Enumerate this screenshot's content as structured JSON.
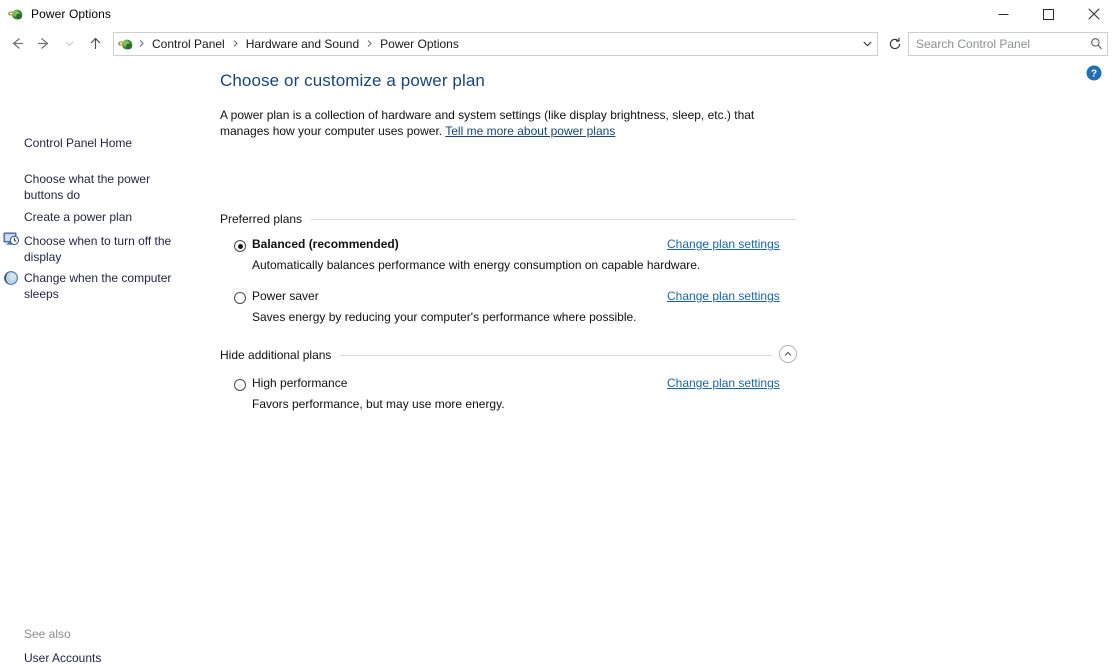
{
  "window": {
    "title": "Power Options",
    "icon": "power-plug-icon",
    "controls": {
      "minimize": "—",
      "maximize": "□",
      "close": "✕"
    }
  },
  "nav": {
    "back_icon": "arrow-left-icon",
    "forward_icon": "arrow-right-icon",
    "recent_icon": "chevron-down-icon",
    "up_icon": "arrow-up-icon",
    "address_icon": "power-plug-icon",
    "breadcrumbs": [
      "Control Panel",
      "Hardware and Sound",
      "Power Options"
    ],
    "separator": "›",
    "dropdown_icon": "chevron-down-icon",
    "refresh_icon": "refresh-icon"
  },
  "search": {
    "placeholder": "Search Control Panel",
    "icon": "search-icon"
  },
  "help": {
    "label": "?",
    "tooltip": "Help",
    "icon": "help-icon"
  },
  "sidebar": {
    "items": [
      {
        "label": "Control Panel Home",
        "icon": null
      },
      {
        "label": "Choose what the power buttons do",
        "icon": null
      },
      {
        "label": "Create a power plan",
        "icon": null
      },
      {
        "label": "Choose when to turn off the display",
        "icon": "monitor-clock-icon"
      },
      {
        "label": "Change when the computer sleeps",
        "icon": "sleep-moon-icon"
      }
    ],
    "see_also_label": "See also",
    "see_also_links": [
      "User Accounts"
    ]
  },
  "main": {
    "title": "Choose or customize a power plan",
    "intro_text": "A power plan is a collection of hardware and system settings (like display brightness, sleep, etc.) that manages how your computer uses power. ",
    "intro_link": "Tell me more about power plans",
    "sections": [
      {
        "header": "Preferred plans",
        "collapsible": false,
        "plans": [
          {
            "name": "Balanced (recommended)",
            "bold": true,
            "selected": true,
            "description": "Automatically balances performance with energy consumption on capable hardware.",
            "action": "Change plan settings"
          },
          {
            "name": "Power saver",
            "bold": false,
            "selected": false,
            "description": "Saves energy by reducing your computer's performance where possible.",
            "action": "Change plan settings"
          }
        ]
      },
      {
        "header": "Hide additional plans",
        "collapsible": true,
        "collapse_icon": "chevron-up-icon",
        "plans": [
          {
            "name": "High performance",
            "bold": false,
            "selected": false,
            "description": "Favors performance, but may use more energy.",
            "action": "Change plan settings"
          }
        ]
      }
    ]
  },
  "colors": {
    "title_blue": "#17457f",
    "link_blue": "#1667b1",
    "sidebar_text": "#1f2340",
    "rule": "#d9d9d9",
    "help_blue": "#1f6fb5"
  }
}
